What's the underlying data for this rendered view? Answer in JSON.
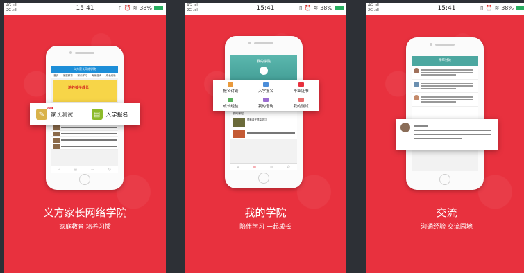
{
  "status_bar": {
    "signal_top": "4G .ııll",
    "signal_bottom": "2G .ııll",
    "time": "15:41",
    "battery": "38%"
  },
  "colors": {
    "panel_bg": "#e8313e",
    "app_blue": "#1d8ed8",
    "app_teal": "#4ca7a0"
  },
  "panels": [
    {
      "title": "义方家长网络学院",
      "subtitle": "家庭教育   培养习惯",
      "screen_header": "义方家长网络学院",
      "screen_tabs": [
        "首页",
        "家庭教育",
        "家长学习",
        "专家咨询",
        "成长经验"
      ],
      "banner_text": "培养孩子成长",
      "section_label": "今日学习",
      "section_more": "换一批",
      "popup_items": [
        {
          "label": "家长测试",
          "icon": "pencil-icon",
          "badge": "NEW"
        },
        {
          "label": "入学报名",
          "icon": "form-icon"
        }
      ]
    },
    {
      "title": "我的学院",
      "subtitle": "陪伴学习   一起成长",
      "screen_header": "我的学院",
      "course_label": "我的课程",
      "course_item": "帮助孩子提高学习",
      "popup_items": [
        {
          "label": "报名讨论",
          "icon": "chat-icon"
        },
        {
          "label": "入学报名",
          "icon": "form-icon"
        },
        {
          "label": "毕业证书",
          "icon": "certificate-icon"
        },
        {
          "label": "成长经验",
          "icon": "book-icon"
        },
        {
          "label": "我的咨询",
          "icon": "question-icon"
        },
        {
          "label": "我的测试",
          "icon": "test-icon"
        }
      ]
    },
    {
      "title": "交流",
      "subtitle": "沟通经验   交流园地",
      "screen_header": "精华讨论"
    }
  ]
}
